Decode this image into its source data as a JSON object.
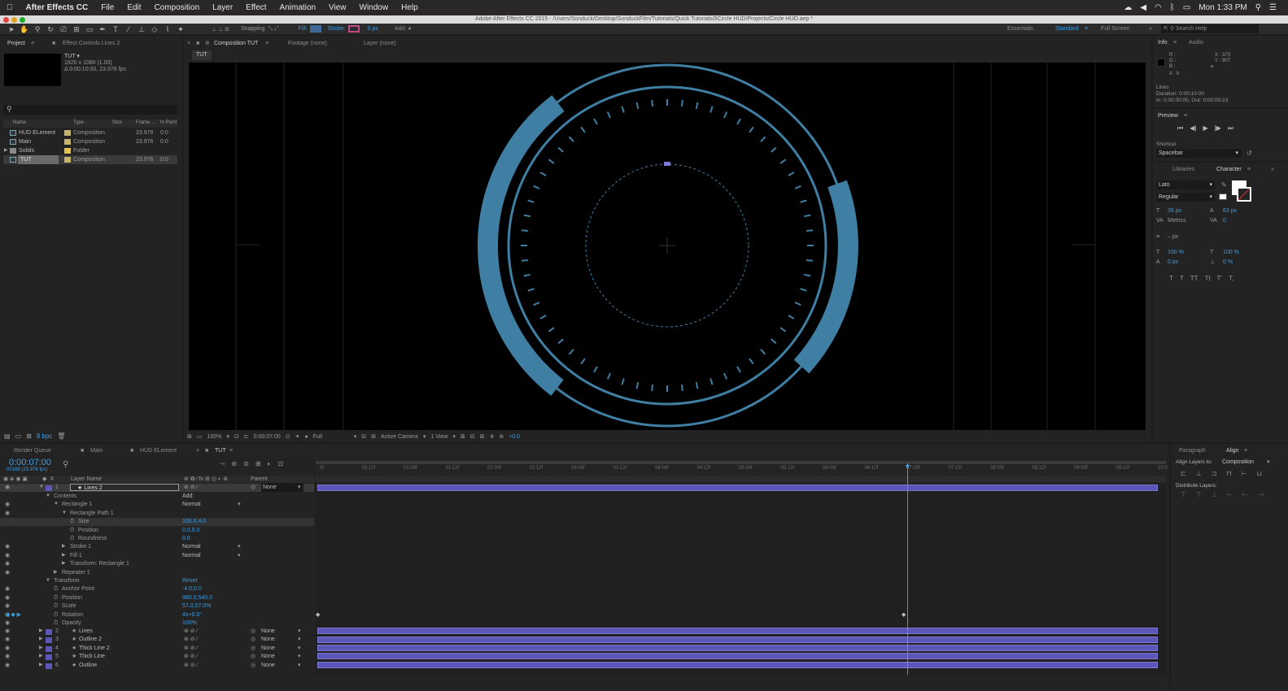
{
  "mac_menu": {
    "apple": "",
    "app": "After Effects CC",
    "items": [
      "File",
      "Edit",
      "Composition",
      "Layer",
      "Effect",
      "Animation",
      "View",
      "Window",
      "Help"
    ],
    "clock": "Mon 1:33 PM"
  },
  "window_title": "Adobe After Effects CC 2015 - /Users/Sonduck/Desktop/SonduckFilm/Tutorials/Quick Tutorials/9Circle HUD/Projects/Circle HUD.aep *",
  "toolbar": {
    "snapping": "Snapping",
    "fill": "Fill:",
    "stroke": "Stroke:",
    "stroke_px": "0 px",
    "add": "Add:",
    "workspaces": [
      "Essentials",
      "Standard",
      "Full Screen"
    ],
    "active_workspace": "Standard",
    "search_help": "Search Help"
  },
  "project_panel": {
    "tabs": [
      "Project",
      "Effect Controls Lines 2"
    ],
    "comp_name": "TUT ▾",
    "comp_res": "1920 x 1080 (1.00)",
    "comp_dur": "Δ 0:00:10:00, 23.976 fps",
    "columns": [
      "Name",
      "Type",
      "Size",
      "Frame ...",
      "In Point"
    ],
    "items": [
      {
        "name": "HUD ELement",
        "type": "Composition",
        "fps": "23.976",
        "in": "0:0",
        "color": "#c8b36a"
      },
      {
        "name": "Main",
        "type": "Composition",
        "fps": "23.976",
        "in": "0:0",
        "color": "#c8b36a"
      },
      {
        "name": "Solids",
        "type": "Folder",
        "fps": "",
        "in": "",
        "color": "#e2c14b"
      },
      {
        "name": "TUT",
        "type": "Composition",
        "fps": "23.976",
        "in": "0:0",
        "color": "#c8b36a"
      }
    ],
    "bpc": "8 bpc"
  },
  "comp_panel": {
    "tabs": [
      "Composition TUT",
      "Footage (none)",
      "Layer (none)"
    ],
    "breadcrumb": "TUT",
    "zoom": "100%",
    "time": "0:00:07:00",
    "resolution": "Full",
    "camera": "Active Camera",
    "view": "1 View",
    "exposure": "+0.0"
  },
  "info_panel": {
    "tabs": [
      "Info",
      "Audio"
    ],
    "rgb": [
      "R :",
      "G :",
      "B :",
      "A : 0"
    ],
    "xy": [
      "X : 373",
      "Y : 907"
    ],
    "layer": "Lines",
    "duration": "Duration: 0:00:10:00",
    "inout": "In: 0:00:00:00, Out: 0:00:09:23"
  },
  "preview_panel": {
    "title": "Preview",
    "shortcut_label": "Shortcut",
    "shortcut": "Spacebar"
  },
  "character_panel": {
    "tabs": [
      "Libraries",
      "Character"
    ],
    "font": "Lato",
    "style": "Regular",
    "size": "36 px",
    "leading": "63 px",
    "kerning": "Metrics",
    "tracking": "0",
    "stroke": "– px",
    "vscale": "100 %",
    "hscale": "100 %",
    "baseline": "0 px",
    "tsume": "0 %",
    "styles": [
      "T",
      "T",
      "TT",
      "Tt",
      "T'",
      "T,"
    ]
  },
  "align_panel": {
    "tabs": [
      "Paragraph",
      "Align"
    ],
    "align_to_label": "Align Layers to:",
    "align_to": "Composition",
    "distribute": "Distribute Layers:"
  },
  "timeline": {
    "tabs": [
      "Render Queue",
      "Main",
      "HUD ELement",
      "TUT"
    ],
    "current_time": "0:00:07:00",
    "frame_info": "00168 (23.976 fps)",
    "columns": [
      "#",
      "Layer Name",
      "Parent"
    ],
    "ruler": [
      "0f",
      "00:12f",
      "01:00f",
      "01:12f",
      "02:00f",
      "02:12f",
      "03:00f",
      "03:12f",
      "04:00f",
      "04:12f",
      "05:00f",
      "05:12f",
      "06:00f",
      "06:12f",
      "07:00f",
      "07:12f",
      "08:00f",
      "08:12f",
      "09:00f",
      "09:12f",
      "10:0"
    ],
    "layer1": {
      "num": "1",
      "name": "Lines 2",
      "parent": "None"
    },
    "props": [
      {
        "indent": 1,
        "label": "Contents",
        "value": "Add:"
      },
      {
        "indent": 2,
        "label": "Rectangle 1",
        "value": "Normal"
      },
      {
        "indent": 3,
        "label": "Rectangle Path 1",
        "value": ""
      },
      {
        "indent": 4,
        "label": "Size",
        "value": "100.0,4.0"
      },
      {
        "indent": 4,
        "label": "Position",
        "value": "0.0,0.0"
      },
      {
        "indent": 4,
        "label": "Roundness",
        "value": "0.0"
      },
      {
        "indent": 3,
        "label": "Stroke 1",
        "value": "Normal"
      },
      {
        "indent": 3,
        "label": "Fill 1",
        "value": "Normal"
      },
      {
        "indent": 3,
        "label": "Transform: Rectangle 1",
        "value": ""
      },
      {
        "indent": 2,
        "label": "Repeater 1",
        "value": ""
      },
      {
        "indent": 1,
        "label": "Transform",
        "value": "Reset"
      },
      {
        "indent": 2,
        "label": "Anchor Point",
        "value": "-4.0,0.0"
      },
      {
        "indent": 2,
        "label": "Position",
        "value": "960.0,540.0"
      },
      {
        "indent": 2,
        "label": "Scale",
        "value": "57.0,57.0%"
      },
      {
        "indent": 2,
        "label": "Rotation",
        "value": "4x+0.0°"
      },
      {
        "indent": 2,
        "label": "Opacity",
        "value": "100%"
      }
    ],
    "layers": [
      {
        "num": "2",
        "name": "Lines",
        "parent": "None"
      },
      {
        "num": "3",
        "name": "Outline 2",
        "parent": "None"
      },
      {
        "num": "4",
        "name": "Thick Line 2",
        "parent": "None"
      },
      {
        "num": "5",
        "name": "Thick Line",
        "parent": "None"
      },
      {
        "num": "6",
        "name": "Outline",
        "parent": "None"
      }
    ],
    "playhead_fraction": 0.7
  },
  "colors": {
    "accent_blue": "#3e9ce0",
    "hud_blue": "#3f7fa3",
    "layer_bar": "#5b56b8"
  }
}
